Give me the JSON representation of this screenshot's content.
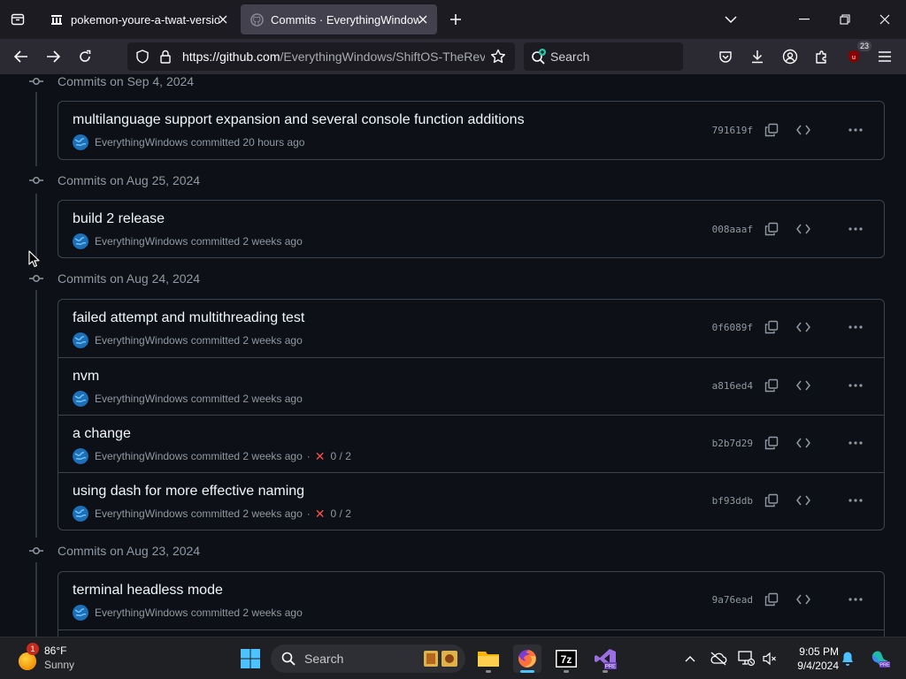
{
  "browser": {
    "tabs": [
      {
        "title": "pokemon-youre-a-twat-version",
        "active": false
      },
      {
        "title": "Commits · EverythingWindows/ShiftOS-TheRevival",
        "active": true
      }
    ],
    "url": {
      "domain": "https://github.com",
      "path": "/EverythingWindows/ShiftOS-TheRevival/commits"
    },
    "search_placeholder": "Search",
    "extensions_badge": "23"
  },
  "commit_groups": [
    {
      "date_label": "Commits on Sep 4, 2024",
      "commits": [
        {
          "title": "multilanguage support expansion and several console function additions",
          "author": "EverythingWindows",
          "when": "committed 20 hours ago",
          "sha": "791619f",
          "checks": ""
        }
      ]
    },
    {
      "date_label": "Commits on Aug 25, 2024",
      "commits": [
        {
          "title": "build 2 release",
          "author": "EverythingWindows",
          "when": "committed 2 weeks ago",
          "sha": "008aaaf",
          "checks": ""
        }
      ]
    },
    {
      "date_label": "Commits on Aug 24, 2024",
      "commits": [
        {
          "title": "failed attempt and multithreading test",
          "author": "EverythingWindows",
          "when": "committed 2 weeks ago",
          "sha": "0f6089f",
          "checks": ""
        },
        {
          "title": "nvm",
          "author": "EverythingWindows",
          "when": "committed 2 weeks ago",
          "sha": "a816ed4",
          "checks": ""
        },
        {
          "title": "a change",
          "author": "EverythingWindows",
          "when": "committed 2 weeks ago",
          "sha": "b2b7d29",
          "checks": "0 / 2"
        },
        {
          "title": "using dash for more effective naming",
          "author": "EverythingWindows",
          "when": "committed 2 weeks ago",
          "sha": "bf93ddb",
          "checks": "0 / 2"
        }
      ]
    },
    {
      "date_label": "Commits on Aug 23, 2024",
      "commits": [
        {
          "title": "terminal headless mode",
          "author": "EverythingWindows",
          "when": "committed 2 weeks ago",
          "sha": "9a76ead",
          "checks": ""
        }
      ]
    }
  ],
  "taskbar": {
    "weather": {
      "temp": "86°F",
      "condition": "Sunny",
      "badge": "1"
    },
    "search_placeholder": "Search",
    "clock": {
      "time": "9:05 PM",
      "date": "9/4/2024"
    },
    "pinned": [
      "file-explorer-icon",
      "firefox-icon",
      "7zip-icon",
      "visual-studio-preview-icon"
    ]
  },
  "colors": {
    "page_bg": "#0d1117",
    "border": "#3d444d",
    "text": "#f0f6fc",
    "muted": "#9198a1",
    "failure": "#f85149",
    "accent": "#4cc2ff"
  }
}
